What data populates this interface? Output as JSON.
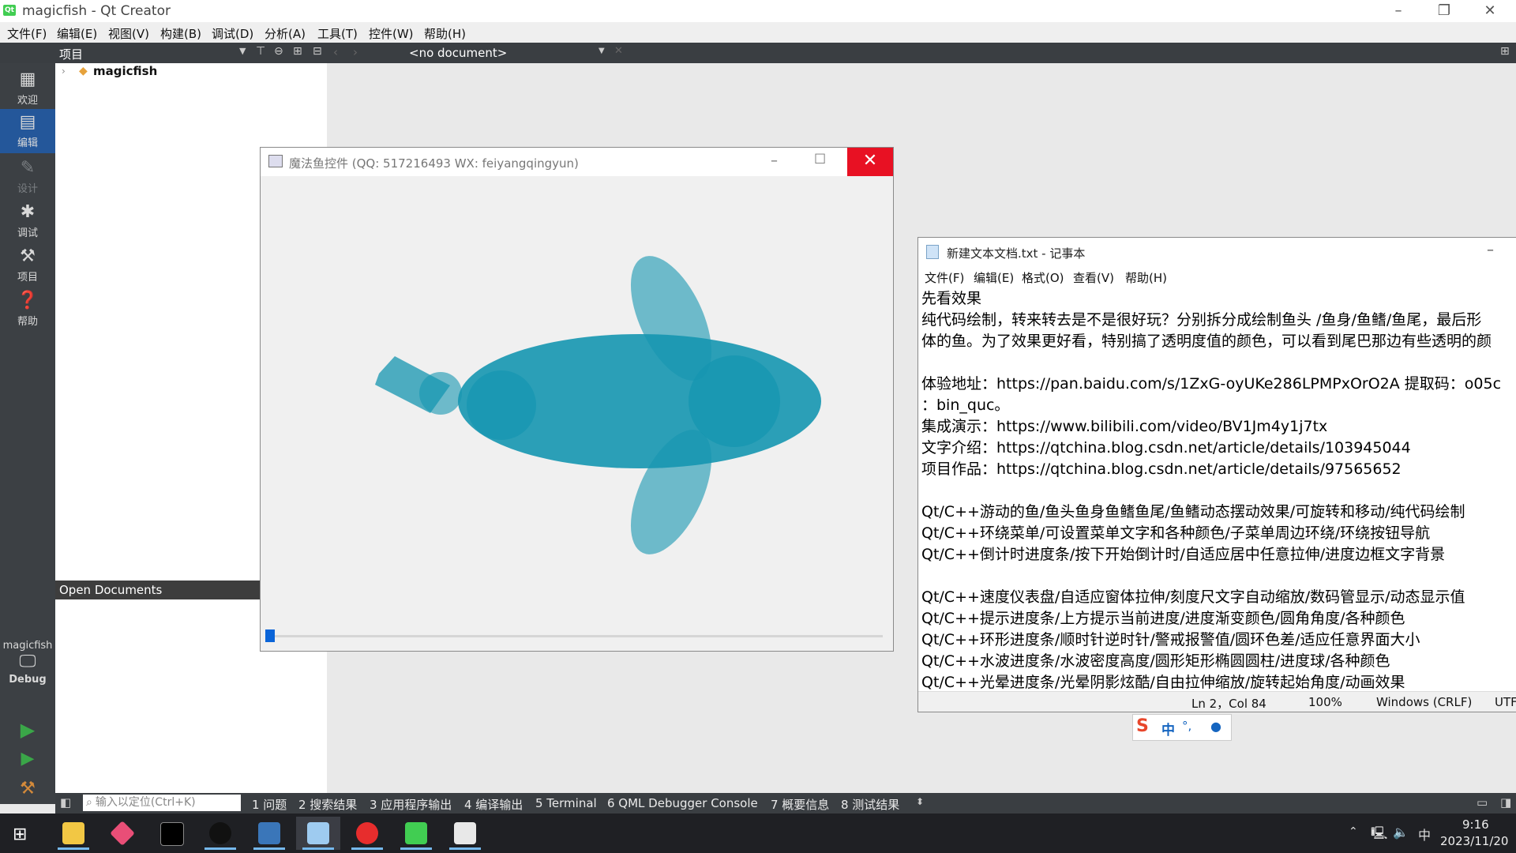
{
  "qt": {
    "title": "magicfish - Qt Creator",
    "menu": [
      "文件(F)",
      "编辑(E)",
      "视图(V)",
      "构建(B)",
      "调试(D)",
      "分析(A)",
      "工具(T)",
      "控件(W)",
      "帮助(H)"
    ],
    "project_label": "项目",
    "document_combo": "<no document>",
    "modes": [
      "欢迎",
      "编辑",
      "设计",
      "调试",
      "项目",
      "帮助"
    ],
    "project_tree_root": "magicfish",
    "open_documents": "Open Documents",
    "kit_project": "magicfish",
    "kit_build": "Debug",
    "locator_placeholder": "输入以定位(Ctrl+K)",
    "output_tabs": [
      "1 问题",
      "2 搜索结果",
      "3 应用程序输出",
      "4 编译输出",
      "5 Terminal",
      "6 QML Debugger Console",
      "7 概要信息",
      "8 测试结果"
    ]
  },
  "fish_window": {
    "title": "魔法鱼控件 (QQ: 517216493 WX: feiyangqingyun)",
    "fish_color": "#1596b0",
    "progress_fraction": 0.015
  },
  "notepad": {
    "title": "新建文本文档.txt - 记事本",
    "menu": [
      "文件(F)",
      "编辑(E)",
      "格式(O)",
      "查看(V)",
      "帮助(H)"
    ],
    "lines": [
      "先看效果",
      "纯代码绘制，转来转去是不是很好玩？分别拆分成绘制鱼头 /鱼身/鱼鳍/鱼尾，最后形",
      "体的鱼。为了效果更好看，特别搞了透明度值的颜色，可以看到尾巴那边有些透明的颜",
      "",
      "体验地址：https://pan.baidu.com/s/1ZxG-oyUKe286LPMPxOrO2A 提取码：o05c",
      "：bin_quc。",
      "集成演示：https://www.bilibili.com/video/BV1Jm4y1j7tx",
      "文字介绍：https://qtchina.blog.csdn.net/article/details/103945044",
      "项目作品：https://qtchina.blog.csdn.net/article/details/97565652",
      "",
      "Qt/C++游动的鱼/鱼头鱼身鱼鳍鱼尾/鱼鳍动态摆动效果/可旋转和移动/纯代码绘制",
      "Qt/C++环绕菜单/可设置菜单文字和各种颜色/子菜单周边环绕/环绕按钮导航",
      "Qt/C++倒计时进度条/按下开始倒计时/自适应居中任意拉伸/进度边框文字背景",
      "",
      "Qt/C++速度仪表盘/自适应窗体拉伸/刻度尺文字自动缩放/数码管显示/动态显示值",
      "Qt/C++提示进度条/上方提示当前进度/进度渐变颜色/圆角角度/各种颜色",
      "Qt/C++环形进度条/顺时针逆时针/警戒报警值/圆环色差/适应任意界面大小",
      "Qt/C++水波进度条/水波密度高度/圆形矩形椭圆圆柱/进度球/各种颜色",
      "Qt/C++光晕进度条/光晕阴影炫酷/自由拉伸缩放/旋转起始角度/动画效果"
    ],
    "status": {
      "position": "Ln 2，Col 84",
      "zoom": "100%",
      "eol": "Windows (CRLF)",
      "encoding": "UTF"
    }
  },
  "ime": {
    "mode": "中"
  },
  "taskbar": {
    "time": "9:16",
    "date": "2023/11/20",
    "lang": "中"
  }
}
